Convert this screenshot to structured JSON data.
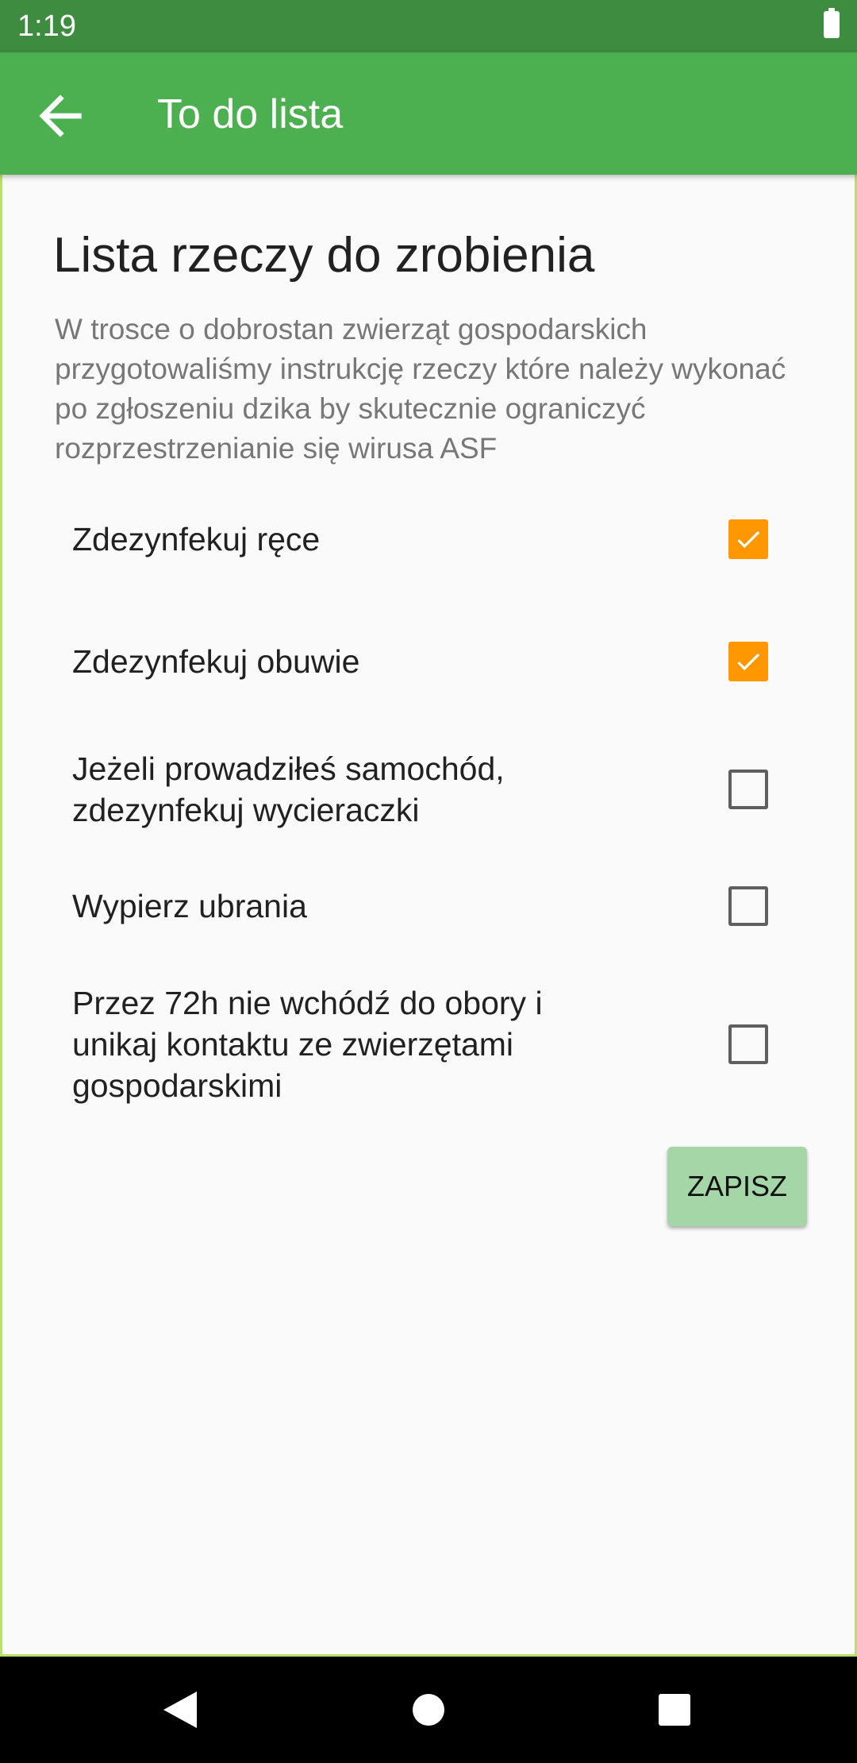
{
  "status_bar": {
    "time": "1:19",
    "battery_icon": "battery-full-icon"
  },
  "app_bar": {
    "back_icon": "arrow-back-icon",
    "title": "To do lista",
    "background": "#4CAF50"
  },
  "main": {
    "heading": "Lista rzeczy do zrobienia",
    "description": "W trosce o dobrostan zwierząt gospodarskich przygotowaliśmy instrukcję rzeczy które należy wykonać po zgłoszeniu dzika by skutecznie ograniczyć rozprzestrzenianie się wirusa ASF",
    "tasks": [
      {
        "label": "Zdezynfekuj ręce",
        "checked": true
      },
      {
        "label": "Zdezynfekuj obuwie",
        "checked": true
      },
      {
        "label": "Jeżeli prowadziłeś samochód, zdezynfekuj wycieraczki",
        "checked": false
      },
      {
        "label": "Wypierz ubrania",
        "checked": false
      },
      {
        "label": "Przez 72h nie wchódź do obory i unikaj kontaktu ze zwierzętami gospodarskimi",
        "checked": false
      }
    ],
    "save_label": "ZAPISZ"
  },
  "colors": {
    "accent": "#FF9800",
    "save_button": "#A5D6A7",
    "status_bar": "#3E8C3F"
  },
  "nav_bar": {
    "back_icon": "nav-back-icon",
    "home_icon": "nav-home-icon",
    "recents_icon": "nav-recents-icon"
  }
}
